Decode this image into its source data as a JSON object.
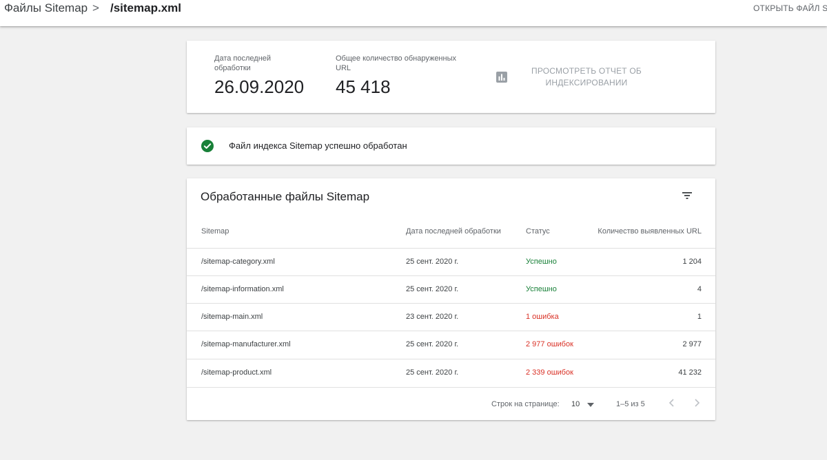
{
  "header": {
    "breadcrumb_root": "Файлы Sitemap",
    "breadcrumb_separator": ">",
    "breadcrumb_current": "/sitemap.xml",
    "open_file_label": "ОТКРЫТЬ ФАЙЛ S"
  },
  "summary": {
    "last_processed_label": "Дата последней обработки",
    "last_processed_value": "26.09.2020",
    "urls_found_label": "Общее количество обнаруженных URL",
    "urls_found_value": "45 418",
    "report_icon": "bar-chart-icon",
    "report_link_label": "ПРОСМОТРЕТЬ ОТЧЕТ ОБ ИНДЕКСИРОВАНИИ"
  },
  "status_card": {
    "icon": "check-circle-icon",
    "message": "Файл индекса Sitemap успешно обработан"
  },
  "table": {
    "title": "Обработанные файлы Sitemap",
    "filter_icon": "filter-icon",
    "columns": {
      "sitemap": "Sitemap",
      "date": "Дата последней обработки",
      "status": "Статус",
      "count": "Количество выявленных URL"
    },
    "rows": [
      {
        "sitemap": "/sitemap-category.xml",
        "date": "25 сент. 2020 г.",
        "status": "Успешно",
        "count": "1 204"
      },
      {
        "sitemap": "/sitemap-information.xml",
        "date": "25 сент. 2020 г.",
        "status": "Успешно",
        "count": "4"
      },
      {
        "sitemap": "/sitemap-main.xml",
        "date": "23 сент. 2020 г.",
        "status": "1 ошибка",
        "count": "1"
      },
      {
        "sitemap": "/sitemap-manufacturer.xml",
        "date": "25 сент. 2020 г.",
        "status": "2 977 ошибок",
        "count": "2 977"
      },
      {
        "sitemap": "/sitemap-product.xml",
        "date": "25 сент. 2020 г.",
        "status": "2 339 ошибок",
        "count": "41 232"
      }
    ],
    "pagination": {
      "rows_per_page_label": "Строк на странице:",
      "rows_per_page_value": "10",
      "range_label": "1–5 из 5"
    }
  },
  "colors": {
    "success": "#188038",
    "error": "#d93025",
    "background": "#f1f1f1"
  }
}
